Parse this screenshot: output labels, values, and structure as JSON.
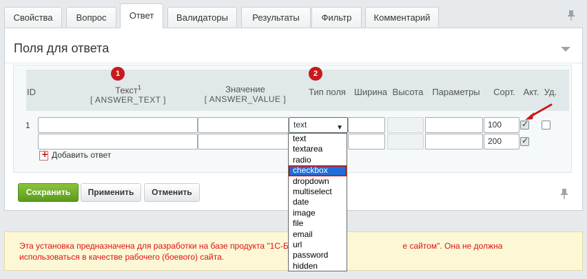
{
  "tabs": [
    {
      "label": "Свойства"
    },
    {
      "label": "Вопрос"
    },
    {
      "label": "Ответ"
    },
    {
      "label": "Валидаторы"
    },
    {
      "label": "Результаты"
    },
    {
      "label": "Фильтр"
    },
    {
      "label": "Комментарий"
    }
  ],
  "panel": {
    "title": "Поля для ответа"
  },
  "table": {
    "headers": {
      "id": "ID",
      "text": "Текст",
      "text_sup": "1",
      "text_code": "[ ANSWER_TEXT ]",
      "value": "Значение",
      "value_code": "[ ANSWER_VALUE ]",
      "type": "Тип поля",
      "width": "Ширина",
      "height": "Высота",
      "params": "Параметры",
      "sort": "Сорт.",
      "active": "Акт.",
      "delete": "Уд."
    },
    "rows": [
      {
        "id": "1",
        "type": "text",
        "sort": "100",
        "active": true,
        "delete": false
      },
      {
        "id": "",
        "sort": "200",
        "active": true
      }
    ],
    "add_answer": "Добавить ответ"
  },
  "badges": [
    "1",
    "2"
  ],
  "field_type_options": [
    "text",
    "textarea",
    "radio",
    "checkbox",
    "dropdown",
    "multiselect",
    "date",
    "image",
    "file",
    "email",
    "url",
    "password",
    "hidden"
  ],
  "field_type_highlighted": "checkbox",
  "buttons": {
    "save": "Сохранить",
    "apply": "Применить",
    "cancel": "Отменить"
  },
  "notice": {
    "text": "Эта установка предназначена для разработки на базе продукта \"1С-Битр                                            е сайтом\". Она не должна использоваться в качестве рабочего (боевого) сайта."
  },
  "colors": {
    "accent_green": "#5a9b1b",
    "badge_red": "#c8191c",
    "highlight_blue": "#1e6fd9",
    "notice_text": "#dd1111"
  }
}
